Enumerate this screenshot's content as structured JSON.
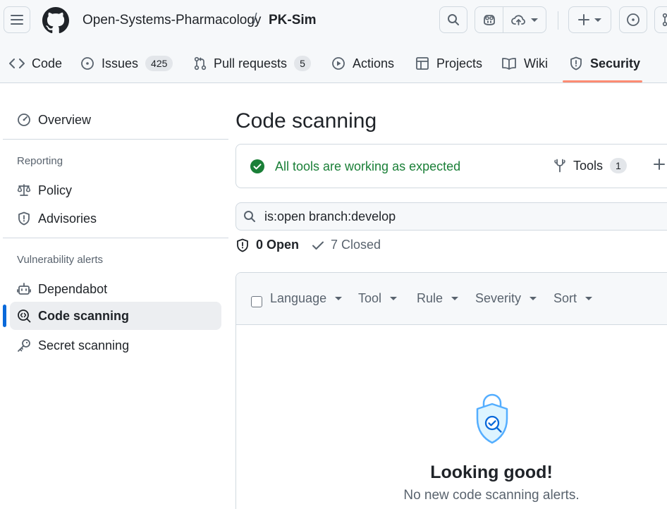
{
  "header": {
    "owner": "Open-Systems-Pharmacology",
    "separator": "/",
    "repo": "PK-Sim"
  },
  "tabs": [
    {
      "label": "Code",
      "icon": "code-icon"
    },
    {
      "label": "Issues",
      "icon": "issue-opened-icon",
      "count": "425"
    },
    {
      "label": "Pull requests",
      "icon": "git-pull-request-icon",
      "count": "5"
    },
    {
      "label": "Actions",
      "icon": "play-icon"
    },
    {
      "label": "Projects",
      "icon": "table-icon"
    },
    {
      "label": "Wiki",
      "icon": "book-icon"
    },
    {
      "label": "Security",
      "icon": "shield-icon",
      "active": true
    }
  ],
  "sidebar": {
    "overview": "Overview",
    "reporting_heading": "Reporting",
    "policy": "Policy",
    "advisories": "Advisories",
    "vuln_heading": "Vulnerability alerts",
    "dependabot": "Dependabot",
    "code_scanning": "Code scanning",
    "secret_scanning": "Secret scanning"
  },
  "main": {
    "title": "Code scanning",
    "status": "All tools are working as expected",
    "tools_label": "Tools",
    "tools_count": "1",
    "filter_value": "is:open branch:develop",
    "open_label": "0 Open",
    "closed_label": "7 Closed",
    "filters": [
      "Language",
      "Tool",
      "Rule",
      "Severity",
      "Sort"
    ],
    "empty_title": "Looking good!",
    "empty_subtitle": "No new code scanning alerts."
  },
  "colors": {
    "accent": "#0969da",
    "success": "#1a7f37",
    "tab_underline": "#fd8c73",
    "empty_icon": "#54aeff"
  }
}
